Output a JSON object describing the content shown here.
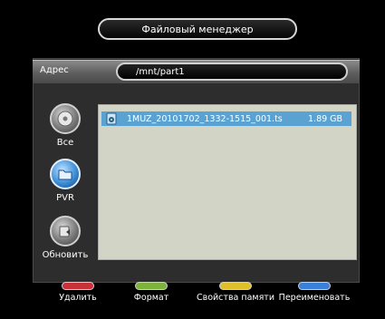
{
  "window": {
    "title": "Файловый менеджер"
  },
  "address": {
    "label": "Адрес",
    "path": "/mnt/part1"
  },
  "sources": [
    {
      "label": "Все",
      "icon": "disc-all-icon"
    },
    {
      "label": "PVR",
      "icon": "pvr-folder-icon",
      "selected": true
    },
    {
      "label": "Обновить",
      "icon": "refresh-icon"
    }
  ],
  "files": [
    {
      "name": "1MUZ_20101702_1332-1515_001.ts",
      "size": "1.89 GB",
      "icon": "media-file-icon",
      "selected": true
    }
  ],
  "footer": [
    {
      "label": "Удалить",
      "color": "#c8303a"
    },
    {
      "label": "Формат",
      "color": "#7db33a"
    },
    {
      "label": "Свойства памяти",
      "color": "#e0c02a"
    },
    {
      "label": "Переименовать",
      "color": "#3a7fd8"
    }
  ],
  "colors": {
    "selection": "#5aa2d2",
    "list_background": "#d2d4c6",
    "panel": "#2d2d2d"
  }
}
